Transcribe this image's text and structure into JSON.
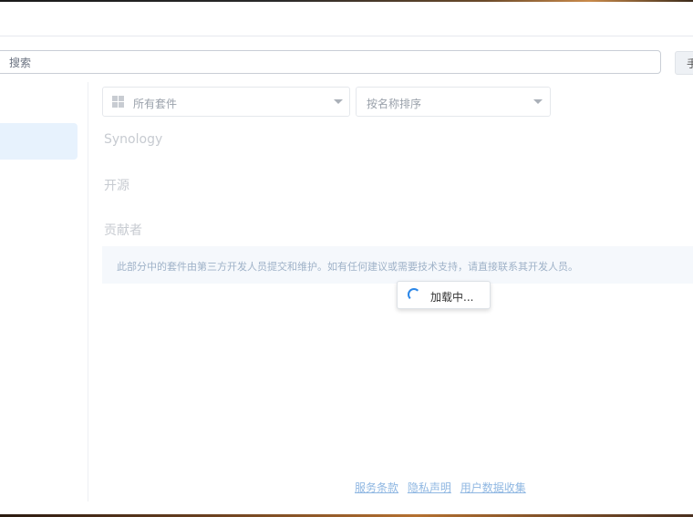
{
  "search": {
    "placeholder": "搜索"
  },
  "header": {
    "manual_button_label": "手"
  },
  "filters": {
    "category": {
      "selected": "所有套件",
      "icon": "grid-icon"
    },
    "sort": {
      "selected": "按名称排序"
    }
  },
  "sections": {
    "synology": "Synology",
    "open_source": "开源",
    "contributors": "贡献者"
  },
  "notice": "此部分中的套件由第三方开发人员提交和维护。如有任何建议或需要技术支持，请直接联系其开发人员。",
  "loading": {
    "text": "加载中..."
  },
  "footer": {
    "terms": "服务条款",
    "privacy": "隐私声明",
    "data_collection": "用户数据收集"
  },
  "colors": {
    "accent": "#2b87e8",
    "sidebar_active_bg": "#e7f2fd",
    "notice_bg": "#f5f8fc",
    "footer_link": "#8fb7e2"
  }
}
